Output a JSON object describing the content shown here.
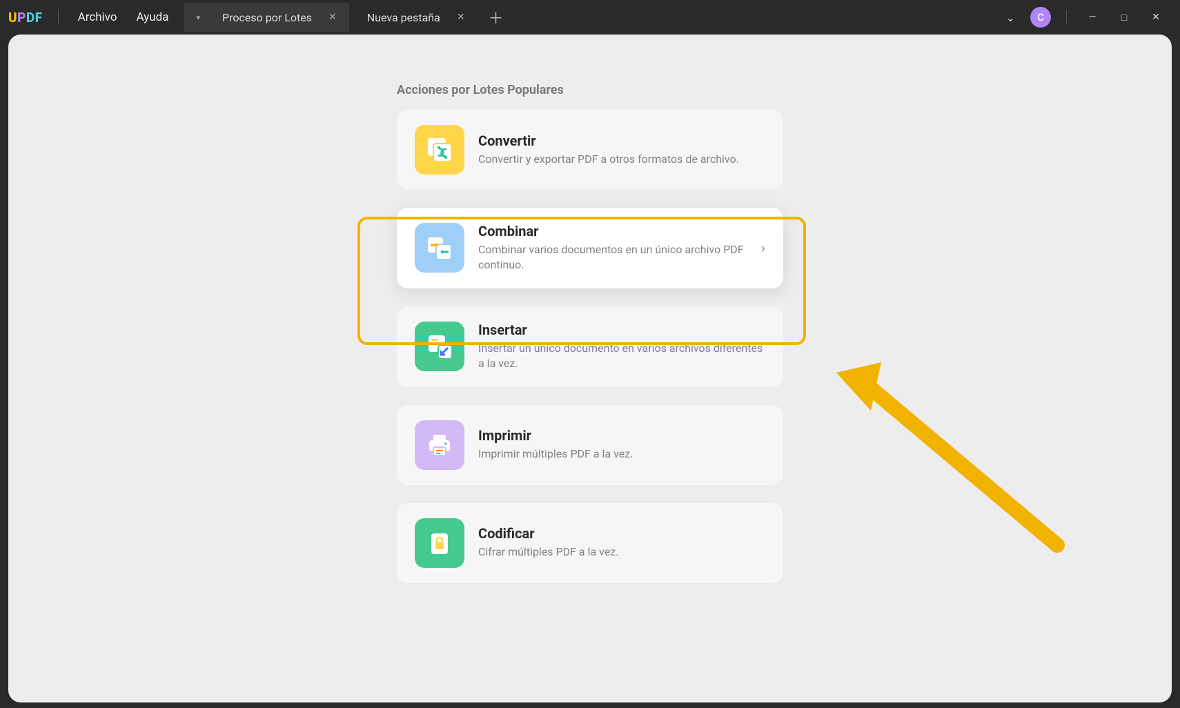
{
  "app": {
    "logo": "UPDF",
    "menu": {
      "file": "Archivo",
      "help": "Ayuda"
    }
  },
  "tabs": {
    "active": {
      "label": "Proceso por Lotes"
    },
    "second": {
      "label": "Nueva pestaña"
    }
  },
  "avatar": {
    "initial": "C"
  },
  "section": {
    "title": "Acciones por Lotes Populares"
  },
  "cards": {
    "convert": {
      "title": "Convertir",
      "desc": "Convertir y exportar PDF a otros formatos de archivo."
    },
    "combine": {
      "title": "Combinar",
      "desc": "Combinar varios documentos en un único archivo PDF continuo."
    },
    "insert": {
      "title": "Insertar",
      "desc": "Insertar un único documento en varios archivos diferentes a la vez."
    },
    "print": {
      "title": "Imprimir",
      "desc": "Imprimir múltiples PDF a la vez."
    },
    "encode": {
      "title": "Codificar",
      "desc": "Cifrar múltiples PDF a la vez."
    }
  }
}
